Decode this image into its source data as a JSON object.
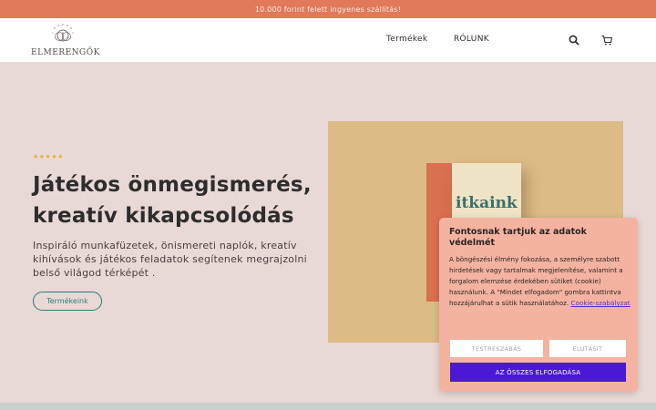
{
  "announcement": {
    "text": "10.000 forint felett ingyenes szállítás!"
  },
  "header": {
    "logo_text": "ELMERENGŐK",
    "nav": {
      "products": "Termékek",
      "about": "RÓLUNK"
    },
    "icons": {
      "search": "search-icon",
      "cart": "cart-icon"
    }
  },
  "hero": {
    "rating_stars": "★★★★★",
    "headline": "Játékos önmegismerés, kreatív kikapcsolódás",
    "subtext": "Inspiráló munkafüzetek, önismereti naplók, kreatív kihívások és játékos feladatok segítenek megrajzolni belső világod térképét .",
    "cta_label": "Termékeink",
    "book_title_visible": "itkaink"
  },
  "cookie": {
    "title": "Fontosnak tartjuk az adatok védelmét",
    "body": "A böngészési élmény fokozása, a személyre szabott hirdetések vagy tartalmak megjelenítése, valamint a forgalom elemzése érdekében sütiket (cookie) használunk. A \"Mindet elfogadom\" gombra kattintva hozzájárulhat a sütik használatához.",
    "policy_link": "Cookie-szabályzat",
    "settings_label": "TESTRESZABÁS",
    "reject_label": "ELUTASÍT",
    "accept_label": "AZ ÖSSZES ELFOGADÁSA"
  },
  "colors": {
    "announce_bg": "#e07a5b",
    "hero_bg": "#e9d9d6",
    "accent_teal": "#2a7b78",
    "cookie_bg": "#f4b3a0",
    "accept_button": "#4b18d6"
  }
}
